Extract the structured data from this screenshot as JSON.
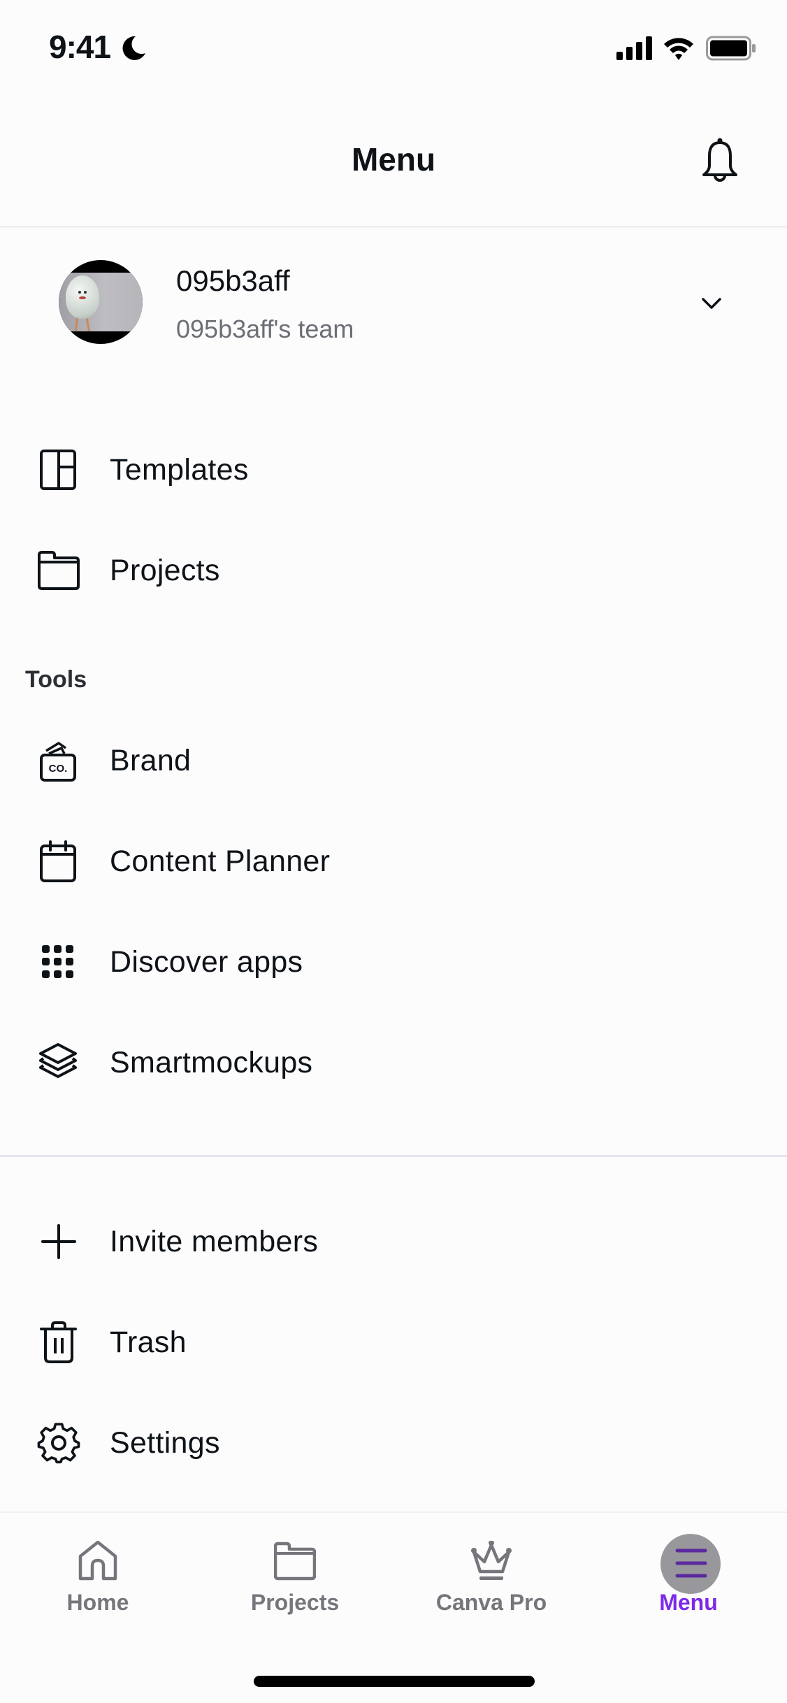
{
  "status_bar": {
    "time": "9:41",
    "icons": [
      "moon-icon",
      "cellular-signal-icon",
      "wifi-icon",
      "battery-icon"
    ]
  },
  "header": {
    "title": "Menu",
    "notification_icon": "bell-icon"
  },
  "account": {
    "name": "095b3aff",
    "team": "095b3aff's team",
    "expand_icon": "chevron-down-icon"
  },
  "main_items": [
    {
      "label": "Templates",
      "icon": "templates-layout-icon"
    },
    {
      "label": "Projects",
      "icon": "folder-icon"
    }
  ],
  "tools": {
    "title": "Tools",
    "items": [
      {
        "label": "Brand",
        "icon": "brand-kit-icon",
        "icon_text": "CO."
      },
      {
        "label": "Content Planner",
        "icon": "calendar-icon"
      },
      {
        "label": "Discover apps",
        "icon": "apps-grid-icon"
      },
      {
        "label": "Smartmockups",
        "icon": "layers-icon"
      }
    ]
  },
  "account_items": [
    {
      "label": "Invite members",
      "icon": "plus-icon"
    },
    {
      "label": "Trash",
      "icon": "trash-icon"
    },
    {
      "label": "Settings",
      "icon": "gear-icon"
    }
  ],
  "bottom_nav": {
    "items": [
      {
        "label": "Home",
        "icon": "home-icon",
        "active": false
      },
      {
        "label": "Projects",
        "icon": "folder-icon",
        "active": false
      },
      {
        "label": "Canva Pro",
        "icon": "crown-icon",
        "active": false
      },
      {
        "label": "Menu",
        "icon": "hamburger-menu-icon",
        "active": true
      }
    ]
  },
  "colors": {
    "accent": "#7d2ae8",
    "text_primary": "#0e1318",
    "text_secondary": "#6b6f75",
    "nav_inactive": "#75767c",
    "background": "#fdfcfd"
  }
}
